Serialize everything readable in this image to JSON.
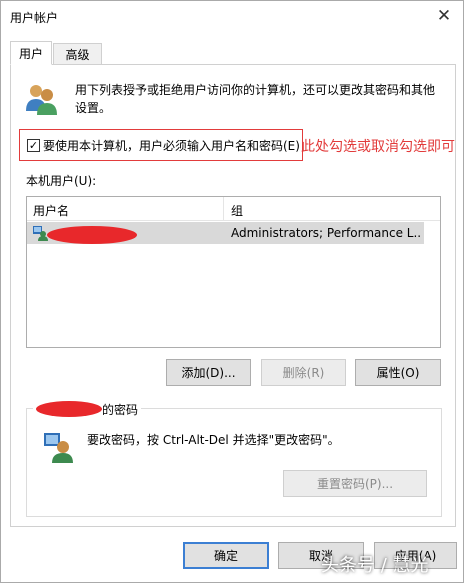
{
  "window": {
    "title": "用户帐户"
  },
  "tabs": [
    {
      "label": "用户"
    },
    {
      "label": "高级"
    }
  ],
  "description": "用下列表授予或拒绝用户访问你的计算机，还可以更改其密码和其他设置。",
  "require_password": {
    "checked": true,
    "label": "要使用本计算机，用户必须输入用户名和密码(E)"
  },
  "annotation": "此处勾选或取消勾选即可",
  "local_users": {
    "label": "本机用户(U):",
    "columns": {
      "user": "用户名",
      "group": "组"
    },
    "rows": [
      {
        "user": "",
        "group": "Administrators; Performance L..."
      }
    ]
  },
  "buttons": {
    "add": "添加(D)...",
    "remove": "删除(R)",
    "properties": "属性(O)",
    "reset_password": "重置密码(P)...",
    "ok": "确定",
    "cancel": "取消",
    "apply": "应用(A)"
  },
  "password_group": {
    "title": "的密码",
    "instruction": "要改密码，按 Ctrl-Alt-Del 并选择\"更改密码\"。"
  },
  "watermark": "头条号 / 慧光",
  "colors": {
    "annotation_red": "#e23b3b",
    "redact_red": "#e8282b",
    "primary_border": "#3c7fd3"
  }
}
